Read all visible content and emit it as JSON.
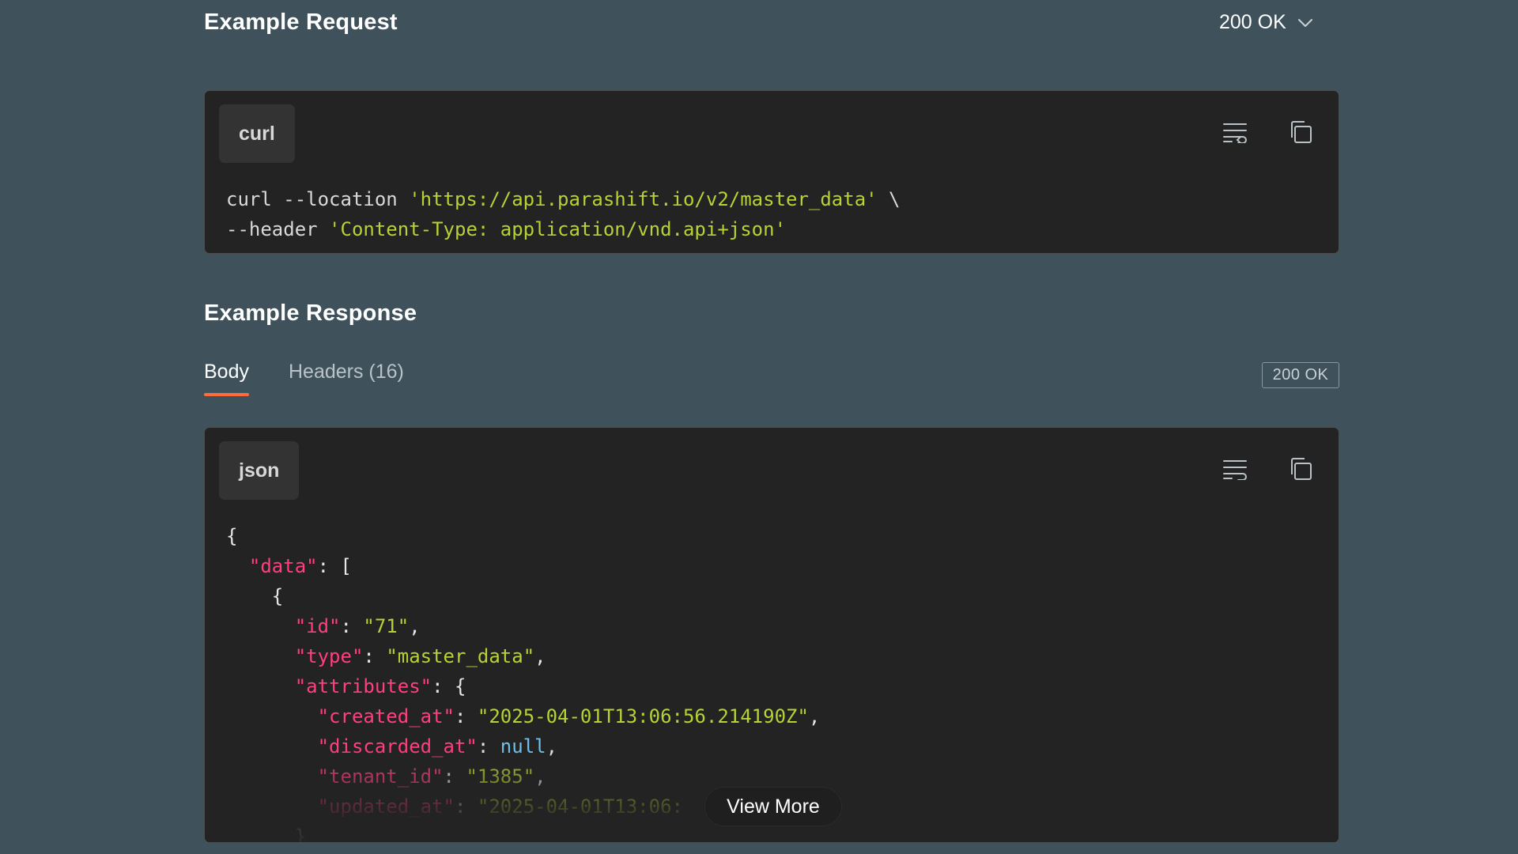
{
  "request": {
    "title": "Example Request",
    "status_select": "200 OK",
    "language": "curl",
    "code_lines": [
      [
        {
          "t": "plain",
          "v": "curl --location "
        },
        {
          "t": "str",
          "v": "'https://api.parashift.io/v2/master_data'"
        },
        {
          "t": "plain",
          "v": " \\"
        }
      ],
      [
        {
          "t": "plain",
          "v": "--header "
        },
        {
          "t": "str",
          "v": "'Content-Type: application/vnd.api+json'"
        }
      ]
    ]
  },
  "response": {
    "title": "Example Response",
    "tabs": [
      {
        "label": "Body",
        "active": true
      },
      {
        "label": "Headers (16)",
        "active": false
      }
    ],
    "status_badge": "200 OK",
    "language": "json",
    "code_lines": [
      [
        {
          "t": "punct",
          "v": "{"
        }
      ],
      [
        {
          "t": "punct",
          "v": "  "
        },
        {
          "t": "key",
          "v": "\"data\""
        },
        {
          "t": "punct",
          "v": ": ["
        }
      ],
      [
        {
          "t": "punct",
          "v": "    {"
        }
      ],
      [
        {
          "t": "punct",
          "v": "      "
        },
        {
          "t": "key",
          "v": "\"id\""
        },
        {
          "t": "punct",
          "v": ": "
        },
        {
          "t": "str",
          "v": "\"71\""
        },
        {
          "t": "punct",
          "v": ","
        }
      ],
      [
        {
          "t": "punct",
          "v": "      "
        },
        {
          "t": "key",
          "v": "\"type\""
        },
        {
          "t": "punct",
          "v": ": "
        },
        {
          "t": "str",
          "v": "\"master_data\""
        },
        {
          "t": "punct",
          "v": ","
        }
      ],
      [
        {
          "t": "punct",
          "v": "      "
        },
        {
          "t": "key",
          "v": "\"attributes\""
        },
        {
          "t": "punct",
          "v": ": {"
        }
      ],
      [
        {
          "t": "punct",
          "v": "        "
        },
        {
          "t": "key",
          "v": "\"created_at\""
        },
        {
          "t": "punct",
          "v": ": "
        },
        {
          "t": "str",
          "v": "\"2025-04-01T13:06:56.214190Z\""
        },
        {
          "t": "punct",
          "v": ","
        }
      ],
      [
        {
          "t": "punct",
          "v": "        "
        },
        {
          "t": "key",
          "v": "\"discarded_at\""
        },
        {
          "t": "punct",
          "v": ": "
        },
        {
          "t": "null",
          "v": "null"
        },
        {
          "t": "punct",
          "v": ","
        }
      ],
      [
        {
          "t": "punct",
          "v": "        "
        },
        {
          "t": "key",
          "v": "\"tenant_id\""
        },
        {
          "t": "punct",
          "v": ": "
        },
        {
          "t": "str",
          "v": "\"1385\""
        },
        {
          "t": "punct",
          "v": ","
        }
      ],
      [
        {
          "t": "punct",
          "v": "        "
        },
        {
          "t": "key",
          "v": "\"updated_at\""
        },
        {
          "t": "punct",
          "v": ": "
        },
        {
          "t": "str",
          "v": "\"2025-04-01T13:06:"
        }
      ],
      [
        {
          "t": "punct",
          "v": "      }"
        }
      ]
    ],
    "view_more_label": "View More"
  },
  "icons": {
    "wrap": "text-wrap-icon",
    "copy": "copy-icon",
    "chevron": "chevron-down-icon"
  },
  "colors": {
    "background": "#3f525c",
    "code_bg": "#232323",
    "accent_tab": "#ff6c37",
    "string": "#b5d334",
    "key": "#ff3f80",
    "null": "#6fc3ec"
  }
}
